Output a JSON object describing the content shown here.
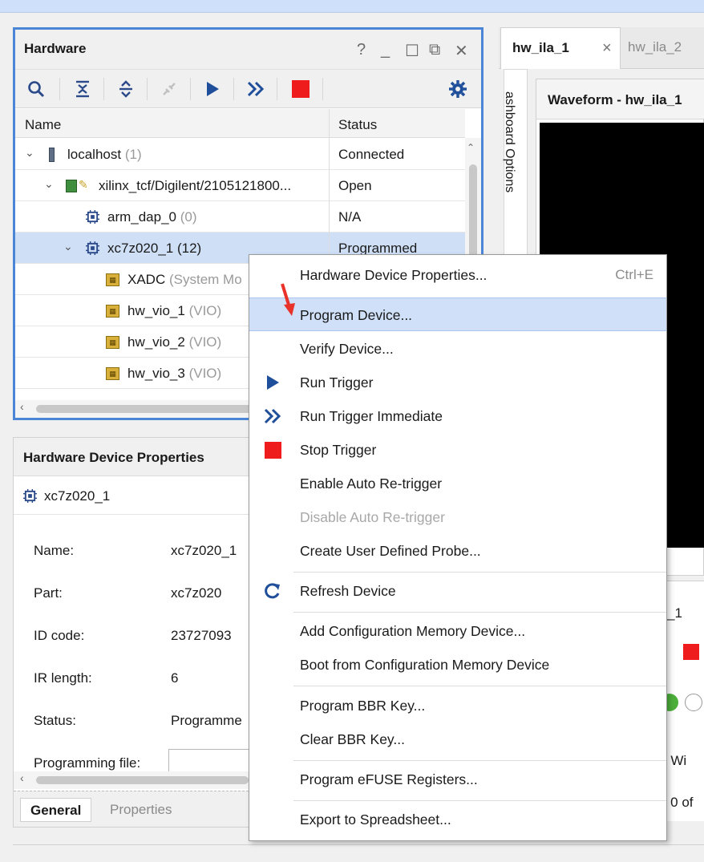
{
  "hardware_panel": {
    "title": "Hardware",
    "window_controls": [
      "?",
      "_",
      "☐",
      "⧉",
      "✕"
    ],
    "columns": {
      "name": "Name",
      "status": "Status"
    },
    "rows": [
      {
        "name": "localhost",
        "count": "(1)",
        "status": "Connected"
      },
      {
        "name": "xilinx_tcf/Digilent/2105121800...",
        "count": "",
        "status": "Open"
      },
      {
        "name": "arm_dap_0",
        "count": "(0)",
        "status": "N/A"
      },
      {
        "name": "xc7z020_1",
        "count": "(12)",
        "status": "Programmed"
      },
      {
        "name": "XADC",
        "count": "(System Mo",
        "status": ""
      },
      {
        "name": "hw_vio_1",
        "count": "(VIO)",
        "status": ""
      },
      {
        "name": "hw_vio_2",
        "count": "(VIO)",
        "status": ""
      },
      {
        "name": "hw_vio_3",
        "count": "(VIO)",
        "status": ""
      }
    ]
  },
  "device_properties_panel": {
    "title": "Hardware Device Properties",
    "device": "xc7z020_1",
    "properties": [
      {
        "label": "Name:",
        "value": "xc7z020_1"
      },
      {
        "label": "Part:",
        "value": "xc7z020"
      },
      {
        "label": "ID code:",
        "value": "23727093"
      },
      {
        "label": "IR length:",
        "value": "6"
      },
      {
        "label": "Status:",
        "value": "Programme"
      },
      {
        "label": "Programming file:",
        "value": ""
      }
    ],
    "tabs": [
      "General",
      "Properties"
    ]
  },
  "ila": {
    "tabs": [
      {
        "label": "hw_ila_1",
        "close": "×"
      },
      {
        "label": "hw_ila_2"
      }
    ],
    "dashboard_label": "ashboard Options",
    "waveform_title": "Waveform - hw_ila_1",
    "partial_texts": {
      "tab_fragment": "_1",
      "wi": "- Wi",
      "e0": "e 0 of"
    }
  },
  "context_menu": {
    "items": [
      {
        "label": "Hardware Device Properties...",
        "shortcut": "Ctrl+E",
        "icon": "",
        "disabled": false
      },
      {
        "label": "Program Device...",
        "shortcut": "",
        "icon": "",
        "disabled": false,
        "highlighted": true
      },
      {
        "label": "Verify Device...",
        "shortcut": "",
        "icon": "",
        "disabled": false
      },
      {
        "label": "Run Trigger",
        "shortcut": "",
        "icon": "run-trigger-icon",
        "disabled": false
      },
      {
        "label": "Run Trigger Immediate",
        "shortcut": "",
        "icon": "run-immediate-icon",
        "disabled": false
      },
      {
        "label": "Stop Trigger",
        "shortcut": "",
        "icon": "stop-icon",
        "disabled": false
      },
      {
        "label": "Enable Auto Re-trigger",
        "shortcut": "",
        "icon": "",
        "disabled": false
      },
      {
        "label": "Disable Auto Re-trigger",
        "shortcut": "",
        "icon": "",
        "disabled": true
      },
      {
        "label": "Create User Defined Probe...",
        "shortcut": "",
        "icon": "",
        "disabled": false
      },
      {
        "label": "Refresh Device",
        "shortcut": "",
        "icon": "refresh-icon",
        "disabled": false
      },
      {
        "label": "Add Configuration Memory Device...",
        "shortcut": "",
        "icon": "",
        "disabled": false
      },
      {
        "label": "Boot from Configuration Memory Device",
        "shortcut": "",
        "icon": "",
        "disabled": false
      },
      {
        "label": "Program BBR Key...",
        "shortcut": "",
        "icon": "",
        "disabled": false
      },
      {
        "label": "Clear BBR Key...",
        "shortcut": "",
        "icon": "",
        "disabled": false
      },
      {
        "label": "Program eFUSE Registers...",
        "shortcut": "",
        "icon": "",
        "disabled": false
      },
      {
        "label": "Export to Spreadsheet...",
        "shortcut": "",
        "icon": "",
        "disabled": false
      }
    ]
  },
  "colors": {
    "accent_blue": "#4b86d6",
    "selection": "#cfdff6",
    "icon_blue": "#2b4a8a",
    "stop_red": "#ee1c1c",
    "chip_gold": "#c9a227",
    "annotation_arrow": "#e8322a"
  }
}
